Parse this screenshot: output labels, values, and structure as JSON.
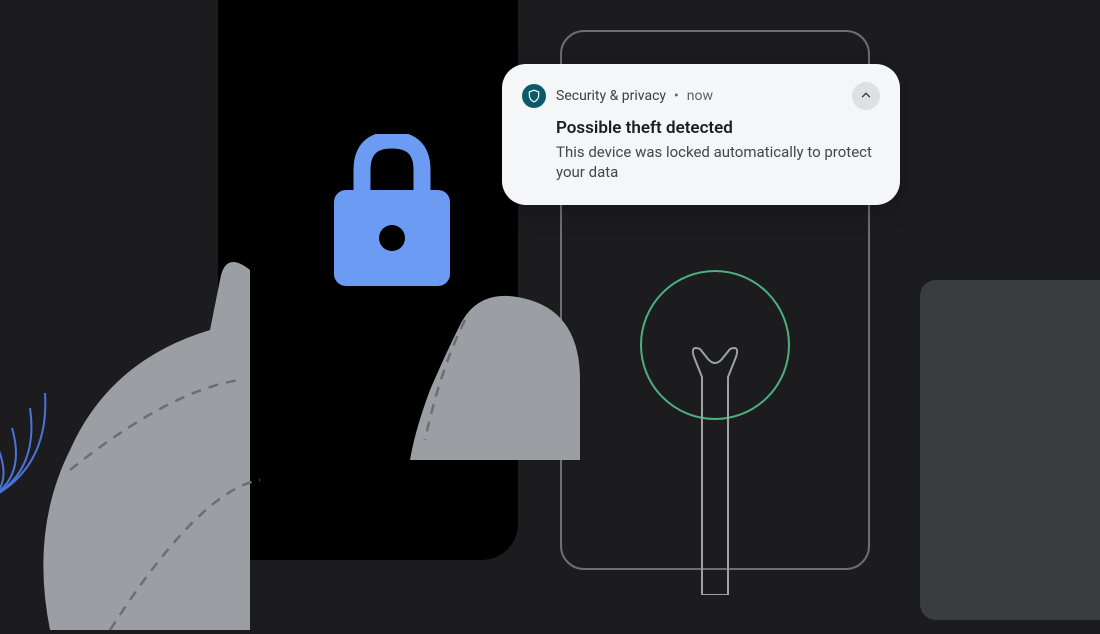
{
  "notification": {
    "app_name": "Security & privacy",
    "time_label": "now",
    "title": "Possible theft detected",
    "message": "This device was locked automatically to protect your data"
  },
  "icons": {
    "lock": "lock-icon",
    "shield": "shield-icon",
    "chevron_up": "chevron-up-icon"
  },
  "colors": {
    "lock_blue": "#6b9bf2",
    "accent_green": "#4caf7d",
    "shield_bg": "#0b5b6b"
  }
}
